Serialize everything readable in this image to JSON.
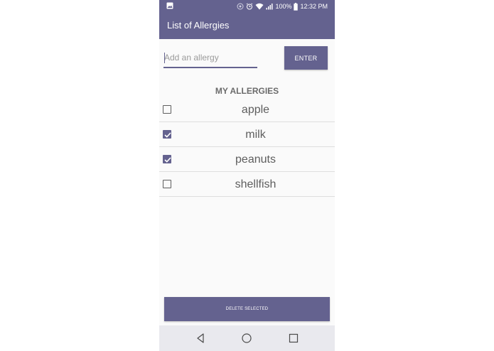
{
  "status_bar": {
    "battery": "100%",
    "time": "12:32 PM",
    "icons": [
      "image-icon",
      "sync-icon",
      "alarm-icon",
      "wifi-icon",
      "signal-icon",
      "battery-icon"
    ]
  },
  "app_bar": {
    "title": "List of Allergies"
  },
  "input": {
    "placeholder": "Add an allergy",
    "value": ""
  },
  "enter_button": {
    "label": "ENTER"
  },
  "list": {
    "heading": "MY ALLERGIES",
    "items": [
      {
        "label": "apple",
        "checked": false
      },
      {
        "label": "milk",
        "checked": true
      },
      {
        "label": "peanuts",
        "checked": true
      },
      {
        "label": "shellfish",
        "checked": false
      }
    ]
  },
  "delete_button": {
    "label": "DELETE SELECTED"
  },
  "nav_bar": {
    "icons": [
      "back-icon",
      "home-icon",
      "recents-icon"
    ]
  },
  "colors": {
    "accent": "#64628f",
    "background": "#fafafa",
    "nav_bar": "#e9e9ee"
  }
}
